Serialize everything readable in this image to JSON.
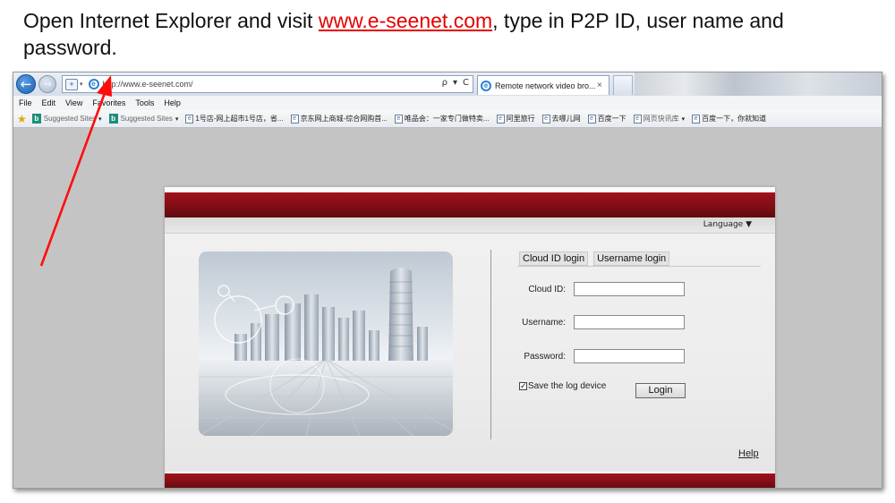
{
  "caption": {
    "before": "Open Internet Explorer and visit ",
    "link": "www.e-seenet.com",
    "after": ", type in P2P ID, user name and password."
  },
  "browser": {
    "address": "http://www.e-seenet.com/",
    "address_tools": [
      "ρ",
      "▾",
      "C"
    ],
    "tab_title": "Remote network video bro...",
    "tab_close": "×",
    "menu": [
      "File",
      "Edit",
      "View",
      "Favorites",
      "Tools",
      "Help"
    ],
    "favorites": [
      {
        "label": "Suggested Sites",
        "icon": "bing-icon",
        "dropdown": "▾"
      },
      {
        "label": "Suggested Sites",
        "icon": "bing-icon",
        "dropdown": "▾"
      },
      {
        "label": "1号店-网上超市1号店，省...",
        "icon": "page-icon"
      },
      {
        "label": "京东网上商城-综合网购首...",
        "icon": "page-icon"
      },
      {
        "label": "唯品会：一家专门做特卖...",
        "icon": "page-icon"
      },
      {
        "label": "阿里旅行",
        "icon": "page-icon"
      },
      {
        "label": "去哪儿网",
        "icon": "page-icon"
      },
      {
        "label": "百度一下",
        "icon": "page-icon"
      },
      {
        "label": "网页快讯库",
        "icon": "page-icon",
        "dropdown": "▾"
      },
      {
        "label": "百度一下，你就知道",
        "icon": "page-icon"
      }
    ]
  },
  "login": {
    "language": "Language ▼",
    "tabs": [
      "Cloud ID login",
      "Username login"
    ],
    "cloud_id_label": "Cloud ID:",
    "cloud_id_value": "",
    "username_label": "Username:",
    "username_value": "",
    "password_label": "Password:",
    "password_value": "",
    "save_label": "Save the log device",
    "save_checked": "✓",
    "login_button": "Login",
    "help": "Help"
  },
  "colors": {
    "accent_red": "#e30000",
    "panel_red": "#8a0f17"
  }
}
